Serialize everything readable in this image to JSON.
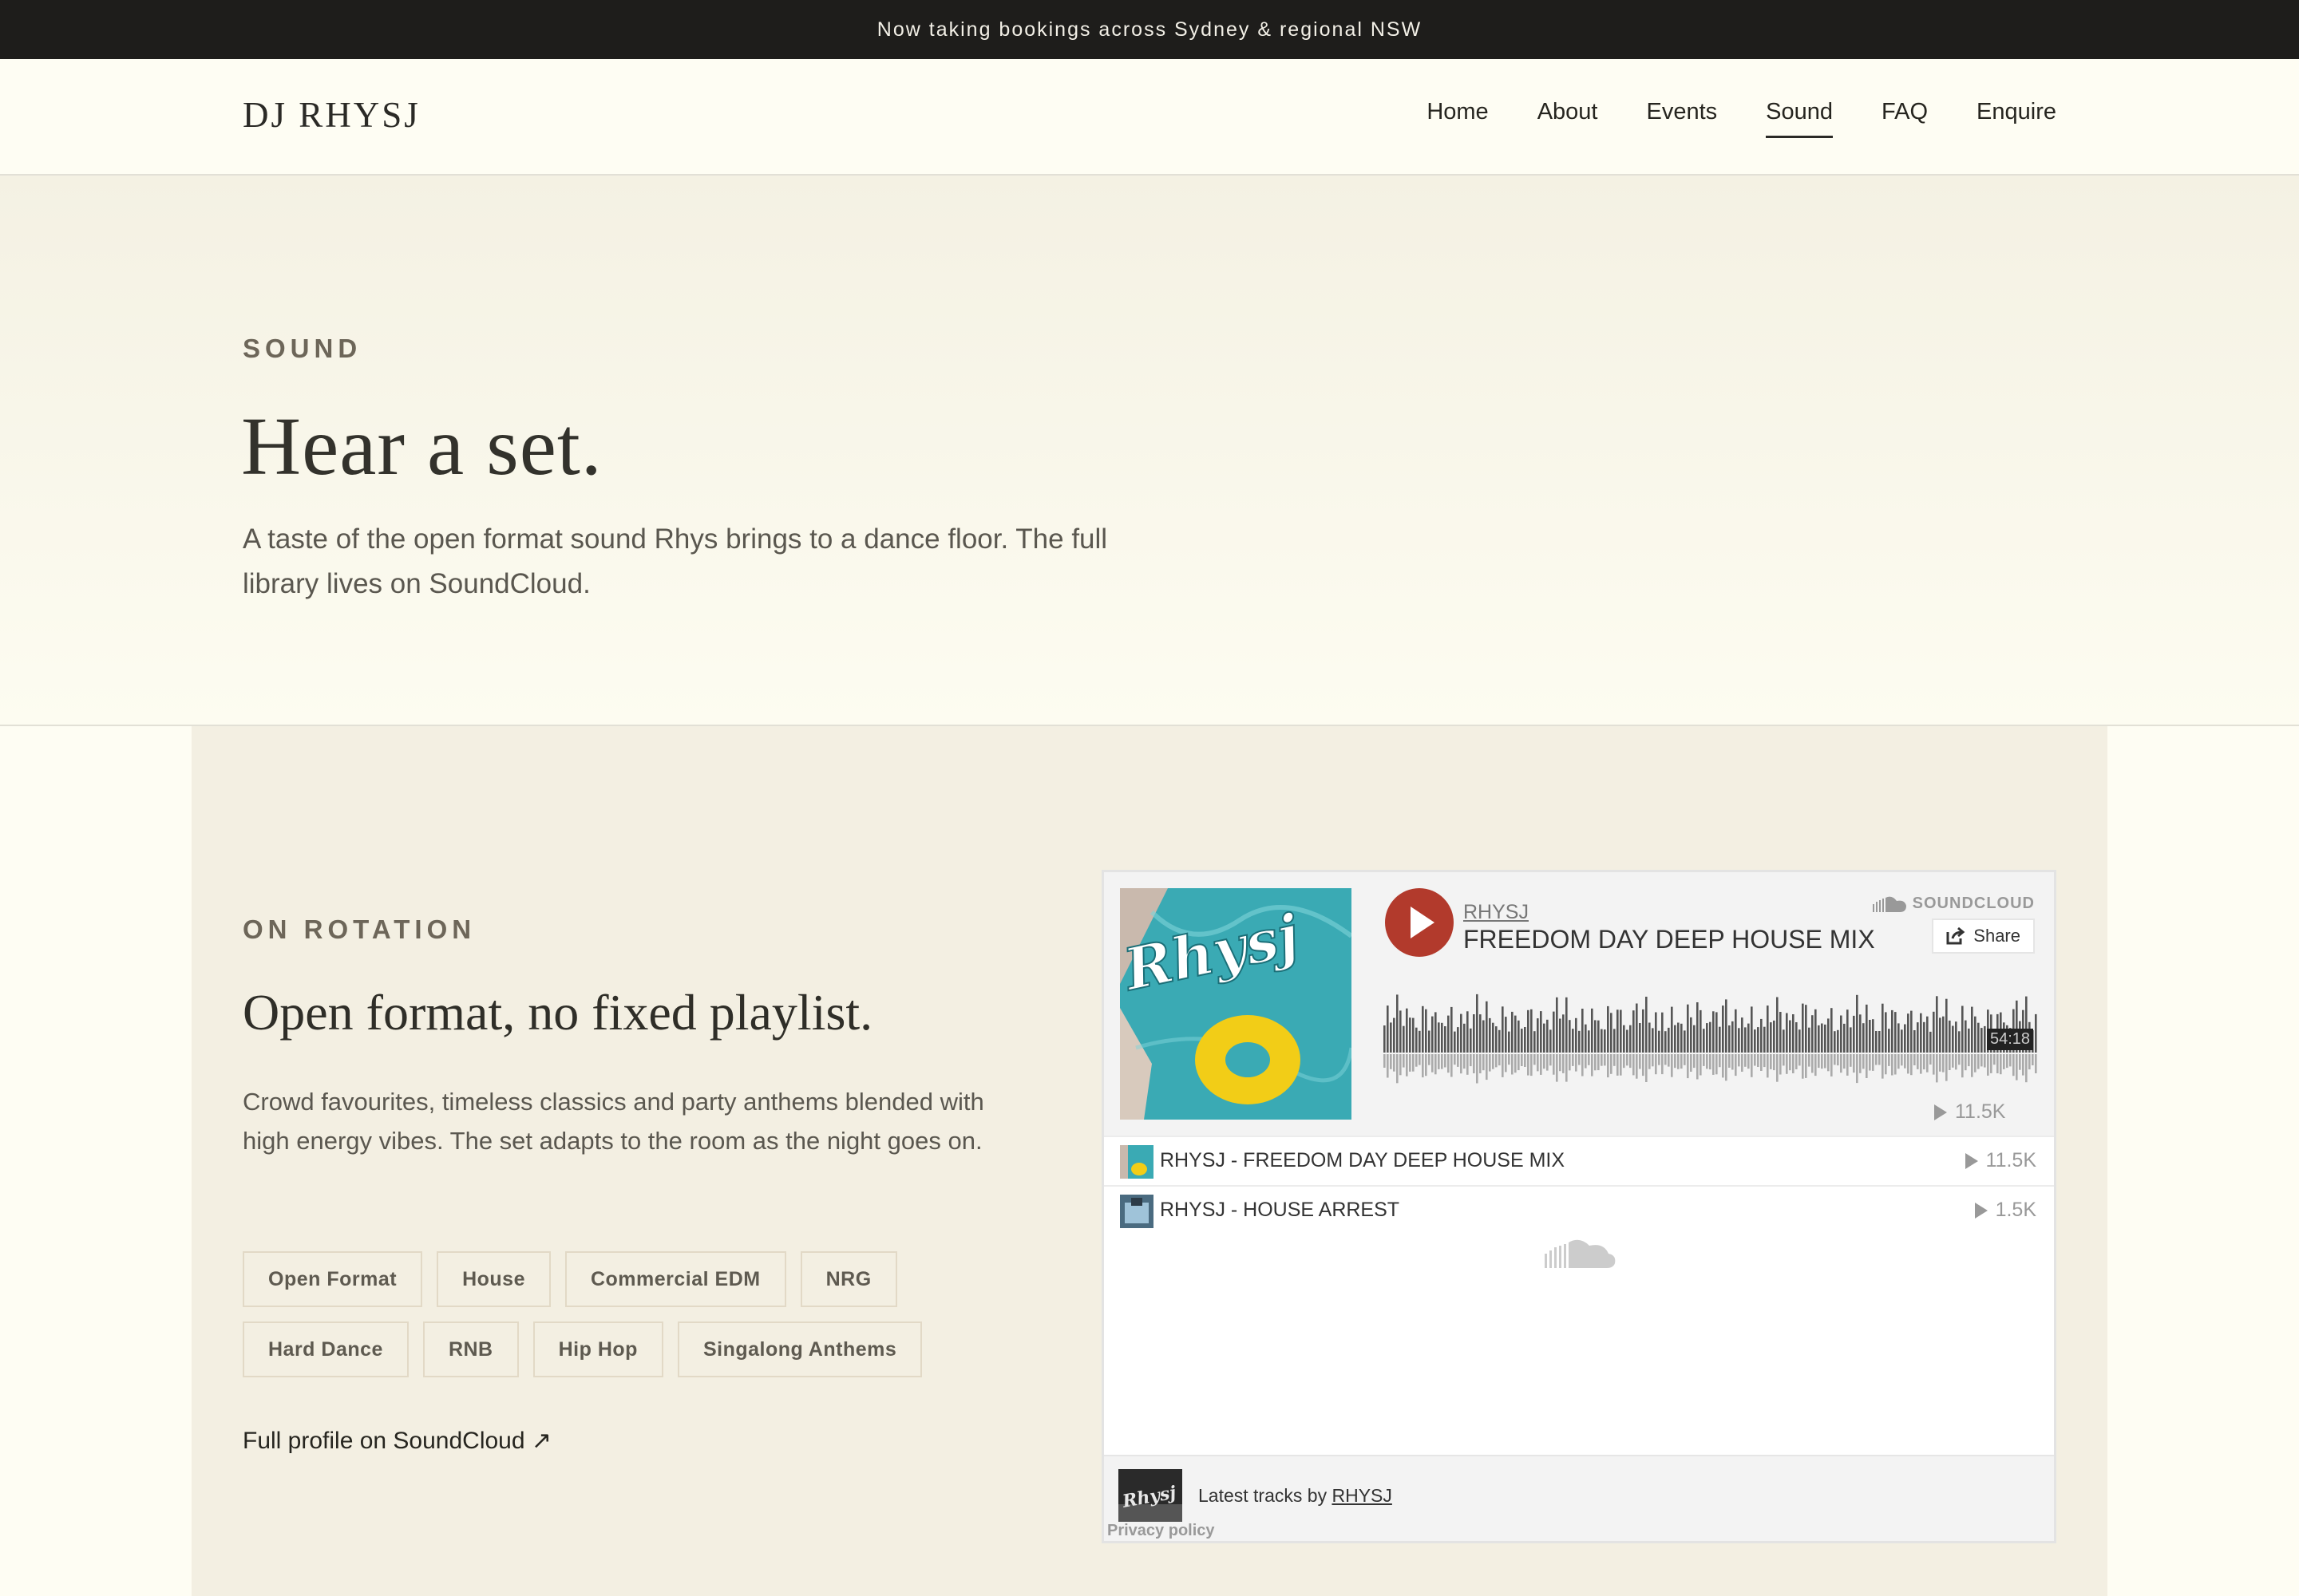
{
  "announcement": "Now taking bookings across Sydney & regional NSW",
  "header": {
    "logo": "DJ RHYSJ",
    "nav": [
      {
        "label": "Home",
        "active": false
      },
      {
        "label": "About",
        "active": false
      },
      {
        "label": "Events",
        "active": false
      },
      {
        "label": "Sound",
        "active": true
      },
      {
        "label": "FAQ",
        "active": false
      },
      {
        "label": "Enquire",
        "active": false
      }
    ]
  },
  "hero": {
    "eyebrow": "SOUND",
    "title": "Hear a set.",
    "text": "A taste of the open format sound Rhys brings to a dance floor. The full library lives on SoundCloud."
  },
  "rotation": {
    "eyebrow": "ON ROTATION",
    "title": "Open format, no fixed playlist.",
    "text": "Crowd favourites, timeless classics and party anthems blended with high energy vibes. The set adapts to the room as the night goes on.",
    "tags": [
      "Open Format",
      "House",
      "Commercial EDM",
      "NRG",
      "Hard Dance",
      "RNB",
      "Hip Hop",
      "Singalong Anthems"
    ],
    "link": "Full profile on SoundCloud ↗"
  },
  "widget": {
    "user": "RHYSJ",
    "title": "FREEDOM DAY DEEP HOUSE MIX",
    "brand": "SOUNDCLOUD",
    "share": "Share",
    "duration": "54:18",
    "plays": "11.5K",
    "art_text": "Rhysj",
    "tracks": [
      {
        "name": "RHYSJ - FREEDOM DAY DEEP HOUSE MIX",
        "plays": "11.5K"
      },
      {
        "name": "RHYSJ - HOUSE ARREST",
        "plays": "1.5K"
      }
    ],
    "footer": {
      "latest_prefix": "Latest tracks by",
      "latest_user": "RHYSJ",
      "privacy": "Privacy policy"
    },
    "colors": {
      "play": "#b23a2c",
      "wave": "#555555"
    }
  }
}
